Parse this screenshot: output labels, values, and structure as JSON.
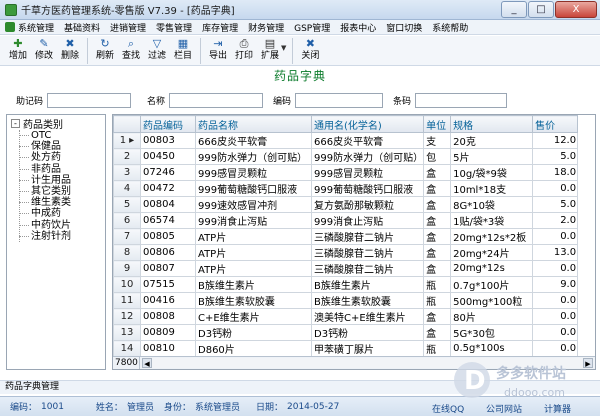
{
  "window": {
    "title": "千草方医药管理系统-零售版 V7.39 - [药品字典]",
    "controls": [
      "_",
      "□",
      "X"
    ]
  },
  "menubar": {
    "items": [
      "系统管理",
      "基础资料",
      "进销管理",
      "零售管理",
      "库存管理",
      "财务管理",
      "GSP管理",
      "报表中心",
      "窗口切换",
      "系统帮助"
    ]
  },
  "toolbar": {
    "buttons": [
      {
        "label": "增加",
        "icon": "add-icon",
        "glyph": "✚",
        "color": "#2e8b2e"
      },
      {
        "label": "修改",
        "icon": "edit-icon",
        "glyph": "✎",
        "color": "#1f5fa8"
      },
      {
        "label": "删除",
        "icon": "delete-icon",
        "glyph": "✖",
        "color": "#1f5fa8"
      },
      {
        "label": "刷新",
        "icon": "refresh-icon",
        "glyph": "↻",
        "color": "#1f5fa8"
      },
      {
        "label": "查找",
        "icon": "find-icon",
        "glyph": "⌕",
        "color": "#1f5fa8"
      },
      {
        "label": "过滤",
        "icon": "filter-icon",
        "glyph": "▽",
        "color": "#1f5fa8"
      },
      {
        "label": "栏目",
        "icon": "columns-icon",
        "glyph": "▦",
        "color": "#1f5fa8"
      },
      {
        "label": "导出",
        "icon": "export-icon",
        "glyph": "⇥",
        "color": "#1f5fa8"
      },
      {
        "label": "打印",
        "icon": "print-icon",
        "glyph": "⎙",
        "color": "#333333"
      },
      {
        "label": "扩展",
        "icon": "extend-icon",
        "glyph": "▤",
        "color": "#333333"
      },
      {
        "label": "关闭",
        "icon": "close-icon",
        "glyph": "✖",
        "color": "#1f5fa8"
      }
    ]
  },
  "page_heading": "药品字典",
  "search": {
    "fields": [
      {
        "label": "助记码",
        "value": ""
      },
      {
        "label": "名称",
        "value": ""
      },
      {
        "label": "编码",
        "value": ""
      },
      {
        "label": "条码",
        "value": ""
      }
    ]
  },
  "tree": {
    "root": "药品类别",
    "toggle": "-",
    "children": [
      "OTC",
      "保健品",
      "处方药",
      "非药品",
      "计生用品",
      "其它类别",
      "维生素类",
      "中成药",
      "中药饮片",
      "注射针剂"
    ]
  },
  "table": {
    "columns": [
      "",
      "药品编码",
      "药品名称",
      "通用名(化学名)",
      "单位",
      "规格",
      "售价"
    ],
    "rows": [
      [
        "1",
        "00803",
        "666皮炎平软膏",
        "666皮炎平软膏",
        "支",
        "20克",
        "12.0"
      ],
      [
        "2",
        "00450",
        "999防水弹力（创可贴）",
        "999防水弹力（创可贴）",
        "包",
        "5片",
        "5.0"
      ],
      [
        "3",
        "07246",
        "999感冒灵颗粒",
        "999感冒灵颗粒",
        "盒",
        "10g/袋*9袋",
        "18.0"
      ],
      [
        "4",
        "00472",
        "999葡萄糖酸钙口服液",
        "999葡萄糖酸钙口服液",
        "盒",
        "10ml*18支",
        "0.0"
      ],
      [
        "5",
        "00804",
        "999速效感冒冲剂",
        "复方氨酚那敏颗粒",
        "盒",
        "8G*10袋",
        "5.0"
      ],
      [
        "6",
        "06574",
        "999消食止泻贴",
        "999消食止泻贴",
        "盒",
        "1贴/袋*3袋",
        "2.0"
      ],
      [
        "7",
        "00805",
        "ATP片",
        "三磷酸腺苷二钠片",
        "盒",
        "20mg*12s*2板",
        "0.0"
      ],
      [
        "8",
        "00806",
        "ATP片",
        "三磷酸腺苷二钠片",
        "盒",
        "20mg*24片",
        "13.0"
      ],
      [
        "9",
        "00807",
        "ATP片",
        "三磷酸腺苷二钠片",
        "盒",
        "20mg*12s",
        "0.0"
      ],
      [
        "10",
        "07515",
        "B族维生素片",
        "B族维生素片",
        "瓶",
        "0.7g*100片",
        "9.0"
      ],
      [
        "11",
        "00416",
        "B族维生素软胶囊",
        "B族维生素软胶囊",
        "瓶",
        "500mg*100粒",
        "0.0"
      ],
      [
        "12",
        "00808",
        "C+E维生素片",
        "澳美特C+E维生素片",
        "盒",
        "80片",
        "0.0"
      ],
      [
        "13",
        "00809",
        "D3钙粉",
        "D3钙粉",
        "盒",
        "5G*30包",
        "0.0"
      ],
      [
        "14",
        "00810",
        "D860片",
        "甲苯磺丁脲片",
        "瓶",
        "0.5g*100s",
        "0.0"
      ]
    ],
    "selected_row_marker": "▸",
    "record_count": "7800"
  },
  "status": {
    "panel_name": "药品字典管理",
    "fields": [
      {
        "key": "编码：",
        "value": "1001"
      },
      {
        "key": "姓名：",
        "value": "管理员"
      },
      {
        "key": "身份：",
        "value": "系统管理员"
      },
      {
        "key": "日期：",
        "value": "2014-05-27"
      }
    ],
    "links": [
      "在线QQ",
      "公司网站",
      "计算器"
    ]
  },
  "watermark": {
    "brand": "多多软件站",
    "url": "ddooo.com"
  }
}
